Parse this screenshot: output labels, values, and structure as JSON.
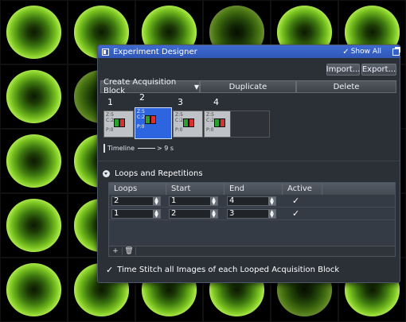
{
  "window": {
    "title": "Experiment Designer",
    "show_all_label": "Show All",
    "show_all_checked": true
  },
  "toolbar": {
    "import_label": "Import...",
    "export_label": "Export..."
  },
  "actions": {
    "create_label": "Create Acquisition Block",
    "duplicate_label": "Duplicate",
    "delete_label": "Delete"
  },
  "blocks": [
    {
      "number": "1",
      "z": "Z:5",
      "c": "C:2",
      "p": "P:0",
      "selected": false
    },
    {
      "number": "2",
      "z": "Z:5",
      "c": "C:2",
      "p": "P:0",
      "selected": true
    },
    {
      "number": "3",
      "z": "Z:5",
      "c": "C:2",
      "p": "P:0",
      "selected": false
    },
    {
      "number": "4",
      "z": "Z:5",
      "c": "C:2",
      "p": "P:0",
      "selected": false
    }
  ],
  "timeline": {
    "label": "Timeline",
    "value": "> 9 s"
  },
  "loops_section": {
    "title": "Loops and Repetitions",
    "columns": [
      "Loops",
      "Start",
      "End",
      "Active"
    ],
    "rows": [
      {
        "loops": "2",
        "start": "1",
        "end": "4",
        "active": true
      },
      {
        "loops": "1",
        "start": "2",
        "end": "3",
        "active": true
      }
    ],
    "add_button": "+",
    "delete_button": "🗑"
  },
  "stitch": {
    "label": "Time Stitch all Images of each Looped Acquisition Block",
    "checked": true
  },
  "colors": {
    "titlebar": "#3e6bd0",
    "panel": "#2b2f36",
    "selected_block": "#2d64e0",
    "channel_green": "#2aa12c",
    "channel_red": "#d93030"
  }
}
